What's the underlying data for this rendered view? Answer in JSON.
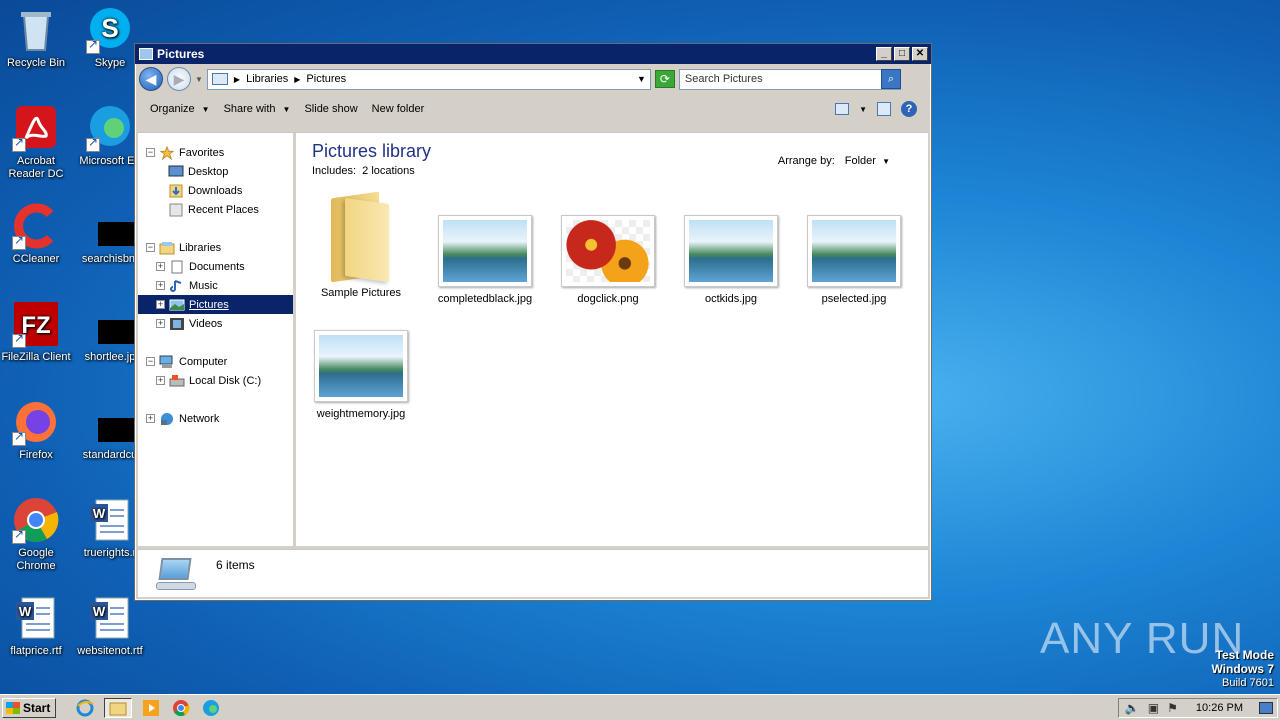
{
  "desktop": {
    "icons": [
      {
        "label": "Recycle Bin",
        "icon": "recycle-bin-icon"
      },
      {
        "label": "Skype",
        "icon": "skype-icon"
      },
      {
        "label": "Acrobat Reader DC",
        "icon": "acrobat-icon"
      },
      {
        "label": "Microsoft Ed",
        "icon": "edge-icon"
      },
      {
        "label": "CCleaner",
        "icon": "ccleaner-icon"
      },
      {
        "label": "searchisbn.",
        "icon": "file-icon"
      },
      {
        "label": "FileZilla Client",
        "icon": "filezilla-icon"
      },
      {
        "label": "shortlee.jp",
        "icon": "file-icon"
      },
      {
        "label": "Firefox",
        "icon": "firefox-icon"
      },
      {
        "label": "standardcu",
        "icon": "file-icon"
      },
      {
        "label": "Google Chrome",
        "icon": "chrome-icon"
      },
      {
        "label": "truerights.r",
        "icon": "word-doc-icon"
      },
      {
        "label": "flatprice.rtf",
        "icon": "word-doc-icon"
      },
      {
        "label": "websitenot.rtf",
        "icon": "word-doc-icon"
      }
    ]
  },
  "window": {
    "title": "Pictures",
    "minimize": "_",
    "maximize": "□",
    "close": "✕",
    "address": {
      "segments": [
        "Libraries",
        "Pictures"
      ]
    },
    "search_placeholder": "Search Pictures",
    "toolbar": {
      "organize": "Organize",
      "share_with": "Share with",
      "slide_show": "Slide show",
      "new_folder": "New folder"
    },
    "nav": {
      "favorites": "Favorites",
      "desktop": "Desktop",
      "downloads": "Downloads",
      "recent_places": "Recent Places",
      "libraries": "Libraries",
      "documents": "Documents",
      "music": "Music",
      "pictures": "Pictures",
      "videos": "Videos",
      "computer": "Computer",
      "local_disk": "Local Disk (C:)",
      "network": "Network"
    },
    "content": {
      "title": "Pictures library",
      "includes_label": "Includes:",
      "includes_value": "2 locations",
      "arrange_label": "Arrange by:",
      "arrange_value": "Folder",
      "items": [
        {
          "name": "Sample Pictures",
          "type": "folder"
        },
        {
          "name": "completedblack.jpg",
          "type": "landscape"
        },
        {
          "name": "dogclick.png",
          "type": "flower"
        },
        {
          "name": "octkids.jpg",
          "type": "landscape"
        },
        {
          "name": "pselected.jpg",
          "type": "landscape"
        },
        {
          "name": "weightmemory.jpg",
          "type": "landscape"
        }
      ]
    },
    "status": {
      "count": "6 items"
    }
  },
  "taskbar": {
    "start": "Start",
    "clock": "10:26 PM"
  },
  "watermark": "ANY RUN",
  "testmode": {
    "line1": "Test Mode",
    "line2": "Windows 7",
    "line3": "Build 7601"
  }
}
